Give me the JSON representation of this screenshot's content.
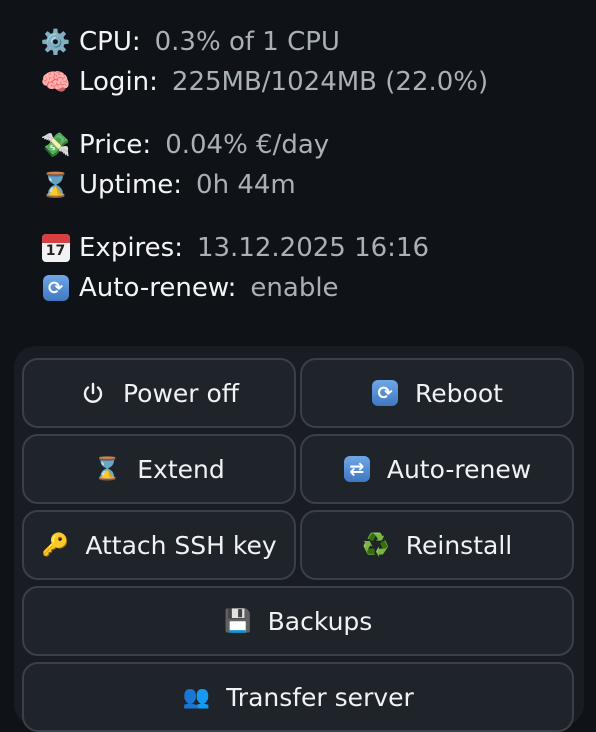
{
  "stats": {
    "cpu": {
      "icon": "gear-icon",
      "label": "CPU:",
      "value": "0.3% of 1 CPU"
    },
    "login": {
      "icon": "brain-icon",
      "label": "Login:",
      "value": "225MB/1024MB (22.0%)"
    },
    "price": {
      "icon": "money-wings-icon",
      "label": "Price:",
      "value": "0.04% €/day"
    },
    "uptime": {
      "icon": "hourglass-icon",
      "label": "Uptime:",
      "value": "0h 44m"
    },
    "expires": {
      "icon": "calendar-icon",
      "label": "Expires:",
      "value": "13.12.2025 16:16",
      "calendar_day": "17"
    },
    "autorenew": {
      "icon": "refresh-icon",
      "label": "Auto-renew:",
      "value": "enable"
    }
  },
  "buttons": {
    "power_off": {
      "icon": "power-icon",
      "label": "Power off"
    },
    "reboot": {
      "icon": "refresh-icon",
      "label": "Reboot"
    },
    "extend": {
      "icon": "hourglass-icon",
      "label": "Extend"
    },
    "auto_renew": {
      "icon": "repeat-icon",
      "label": "Auto-renew"
    },
    "attach_ssh": {
      "icon": "key-icon",
      "label": "Attach SSH key"
    },
    "reinstall": {
      "icon": "recycle-icon",
      "label": "Reinstall"
    },
    "backups": {
      "icon": "floppy-disk-icon",
      "label": "Backups"
    },
    "transfer": {
      "icon": "users-icon",
      "label": "Transfer server"
    }
  },
  "colors": {
    "background": "#0f1318",
    "panel": "#191d23",
    "button": "#1f242b",
    "button_border": "#3a4048",
    "value_text": "#a9b0b8"
  }
}
